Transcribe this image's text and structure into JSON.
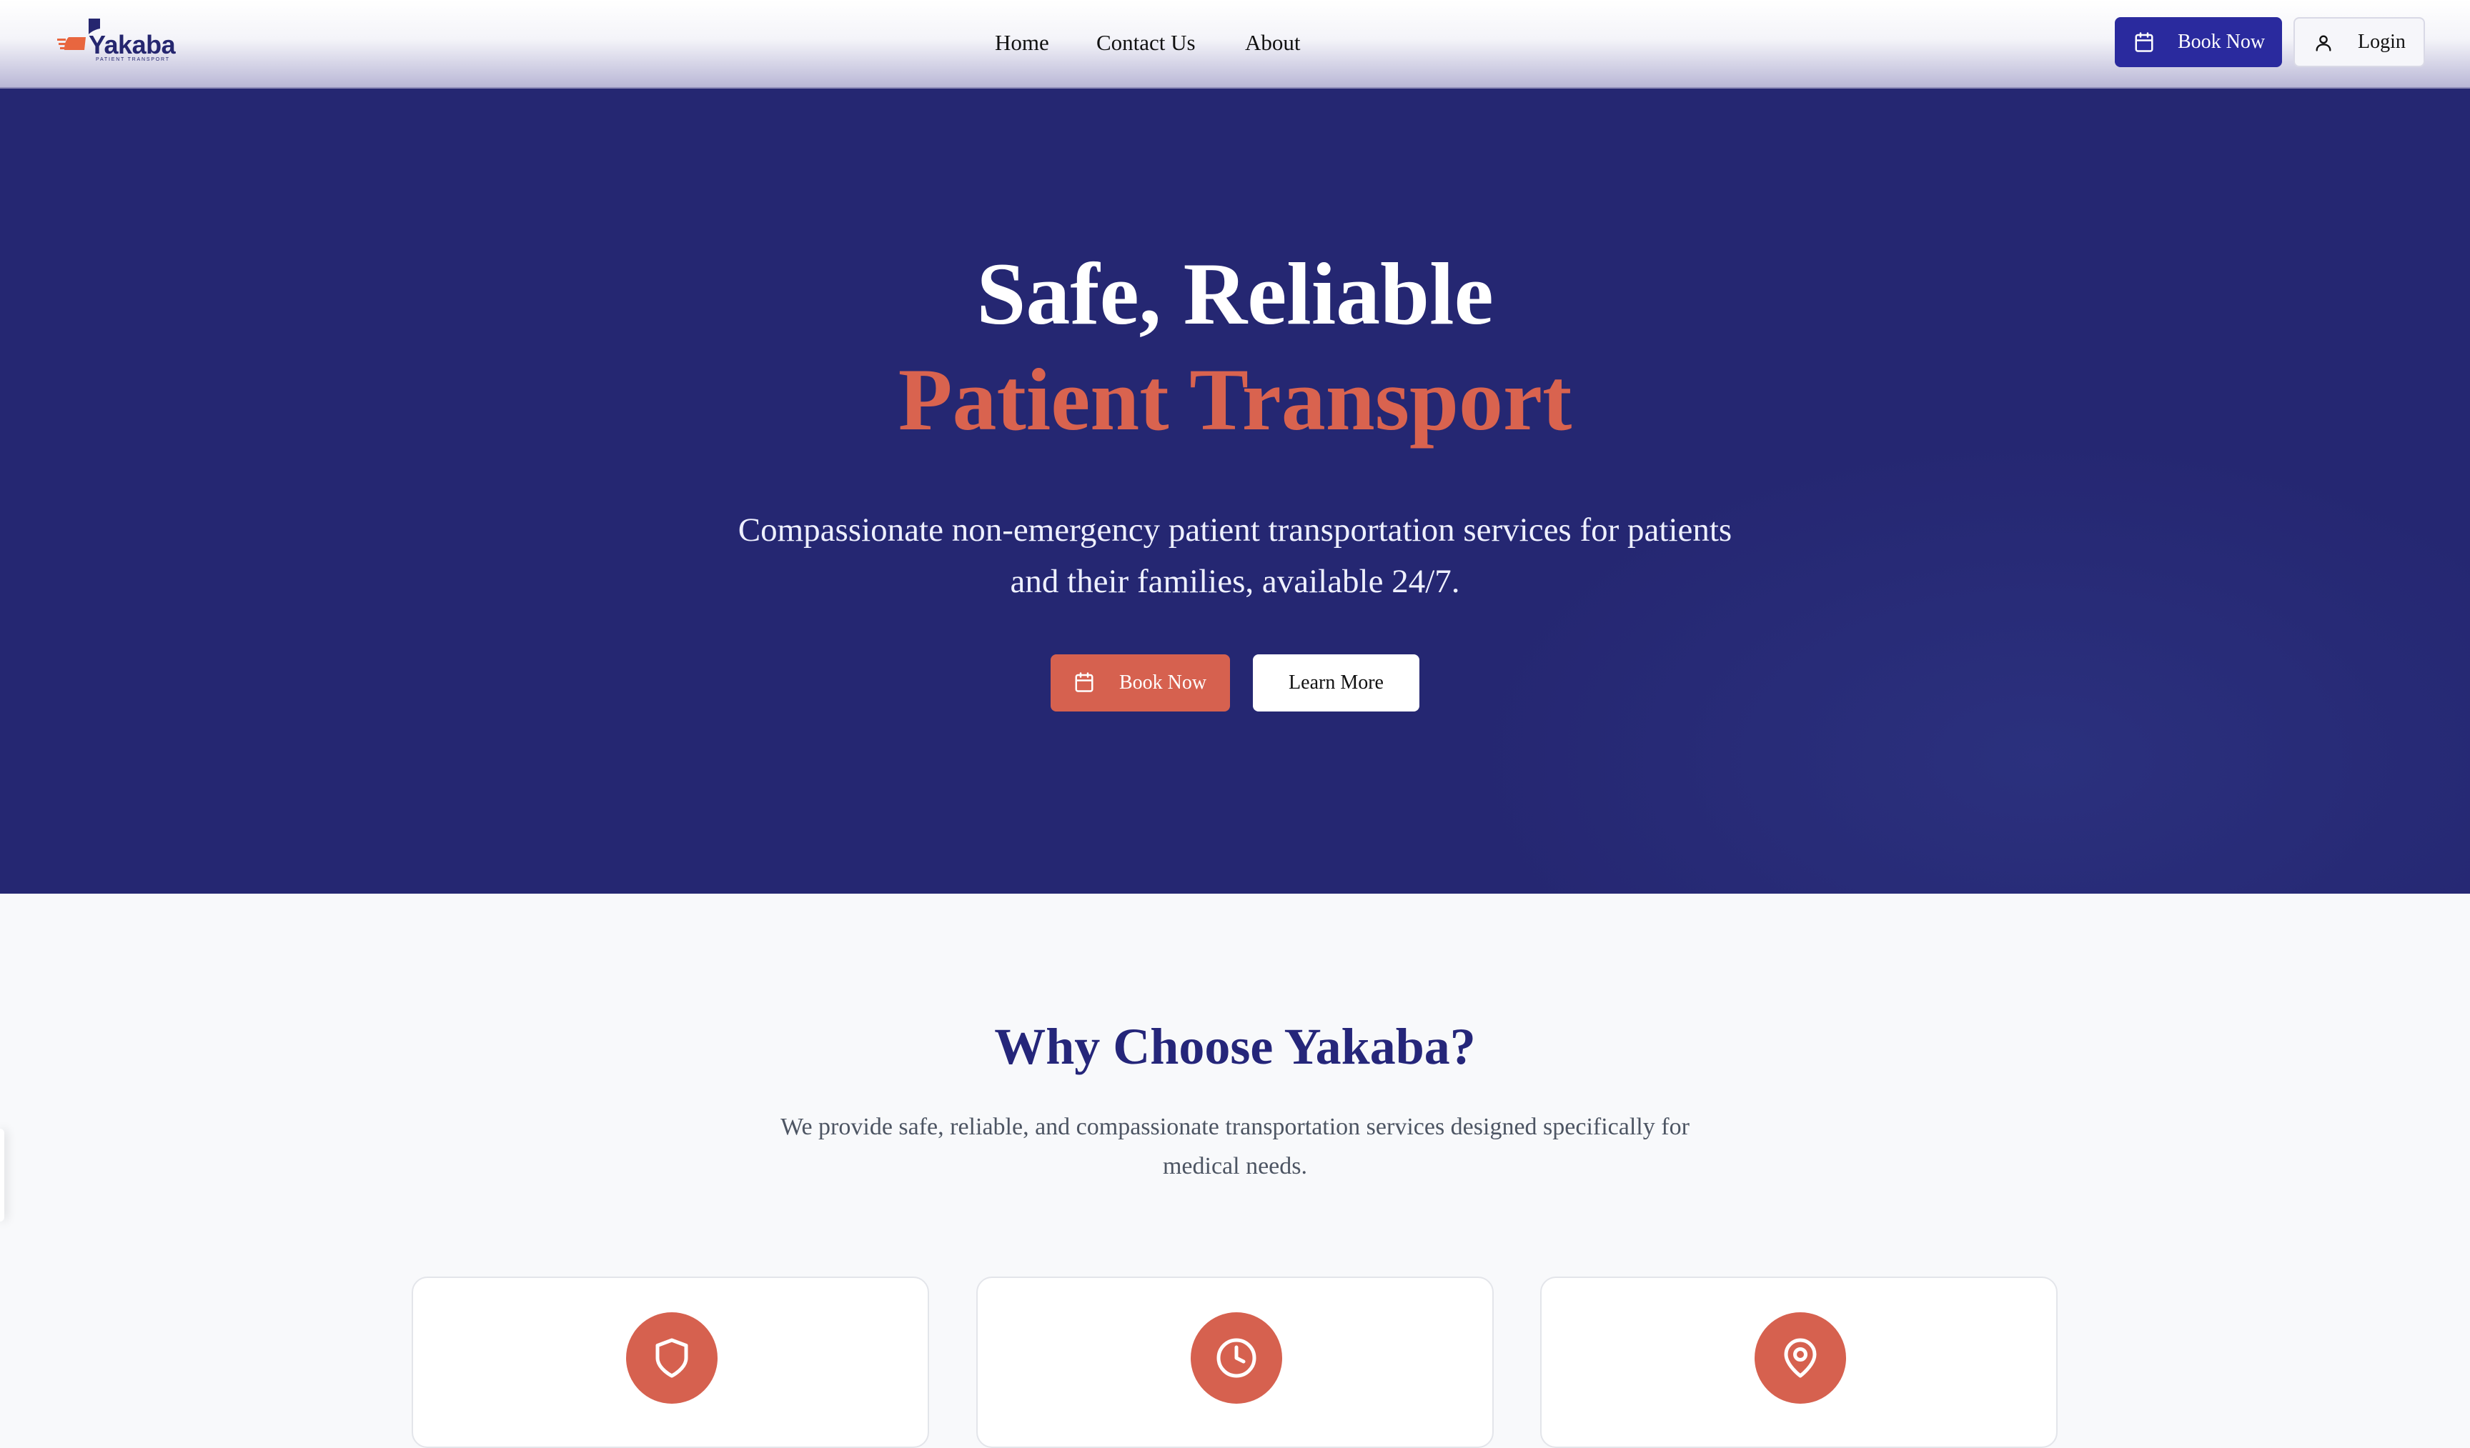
{
  "brand": {
    "name": "Yakaba",
    "tagline": "PATIENT TRANSPORT",
    "colors": {
      "navy": "#252772",
      "coral": "#d6614f",
      "button_blue": "#2a2a9e"
    }
  },
  "nav": {
    "items": [
      {
        "label": "Home"
      },
      {
        "label": "Contact Us"
      },
      {
        "label": "About"
      }
    ]
  },
  "header_actions": {
    "book_label": "Book Now",
    "book_icon": "calendar-icon",
    "login_label": "Login",
    "login_icon": "user-icon"
  },
  "hero": {
    "title_line1": "Safe, Reliable",
    "title_line2": "Patient Transport",
    "subtitle": "Compassionate non-emergency patient transportation services for patients and their families, available 24/7.",
    "primary_label": "Book Now",
    "primary_icon": "calendar-icon",
    "secondary_label": "Learn More"
  },
  "why": {
    "title": "Why Choose Yakaba?",
    "subtitle": "We provide safe, reliable, and compassionate transportation services designed specifically for medical needs.",
    "cards": [
      {
        "icon": "shield-icon"
      },
      {
        "icon": "clock-icon"
      },
      {
        "icon": "map-pin-icon"
      }
    ]
  }
}
